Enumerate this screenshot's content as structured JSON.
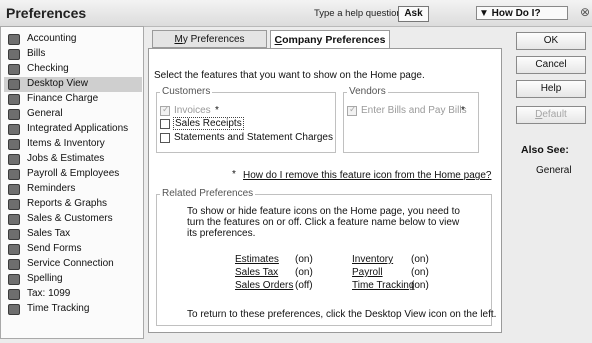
{
  "window": {
    "title": "Preferences",
    "help_label": "Type a help question",
    "ask_label": "Ask",
    "howdoi_label": "▼ How Do I?",
    "close_glyph": "⊗"
  },
  "sidebar": {
    "items": [
      {
        "label": "Accounting",
        "icon": "accounting-icon"
      },
      {
        "label": "Bills",
        "icon": "bills-icon"
      },
      {
        "label": "Checking",
        "icon": "checking-icon"
      },
      {
        "label": "Desktop View",
        "icon": "desktop-view-icon",
        "selected": true
      },
      {
        "label": "Finance Charge",
        "icon": "finance-charge-icon"
      },
      {
        "label": "General",
        "icon": "general-icon"
      },
      {
        "label": "Integrated Applications",
        "icon": "integrated-applications-icon"
      },
      {
        "label": "Items & Inventory",
        "icon": "items-inventory-icon"
      },
      {
        "label": "Jobs & Estimates",
        "icon": "jobs-estimates-icon"
      },
      {
        "label": "Payroll & Employees",
        "icon": "payroll-icon"
      },
      {
        "label": "Reminders",
        "icon": "reminders-icon"
      },
      {
        "label": "Reports & Graphs",
        "icon": "reports-graphs-icon"
      },
      {
        "label": "Sales & Customers",
        "icon": "sales-customers-icon"
      },
      {
        "label": "Sales Tax",
        "icon": "sales-tax-icon"
      },
      {
        "label": "Send Forms",
        "icon": "send-forms-icon"
      },
      {
        "label": "Service Connection",
        "icon": "service-connection-icon"
      },
      {
        "label": "Spelling",
        "icon": "spelling-icon"
      },
      {
        "label": "Tax: 1099",
        "icon": "tax-1099-icon"
      },
      {
        "label": "Time Tracking",
        "icon": "time-tracking-icon"
      }
    ]
  },
  "tabs": {
    "my_prefix": "M",
    "my_rest": "y Preferences",
    "company_prefix": "C",
    "company_rest": "ompany Preferences"
  },
  "panel": {
    "instruction": "Select the features that you want to show on the Home page.",
    "customers_legend": "Customers",
    "invoices_label": "Invoices",
    "invoices_star": "*",
    "sales_receipts_label": "Sales Receipts",
    "statements_label": "Statements and Statement Charges",
    "vendors_legend": "Vendors",
    "bills_label": "Enter Bills and Pay Bills",
    "bills_star": "*",
    "remove_star": "*",
    "remove_link": "How do I remove this feature icon from the Home page?",
    "related_legend": "Related Preferences",
    "related_text_1": "To show or hide feature icons on the Home page, you need to",
    "related_text_2": "turn the features on or off. Click a feature name below to view",
    "related_text_3": "its preferences.",
    "features": [
      {
        "name": "Estimates",
        "status": "(on)"
      },
      {
        "name": "Sales Tax",
        "status": "(on)"
      },
      {
        "name": "Sales Orders",
        "status": "(off)"
      },
      {
        "name": "Inventory",
        "status": "(on)"
      },
      {
        "name": "Payroll",
        "status": "(on)"
      },
      {
        "name": "Time Tracking",
        "status": "(on)"
      }
    ],
    "return_text": "To return to these preferences, click the Desktop View icon on the left."
  },
  "buttons": {
    "ok": "OK",
    "cancel": "Cancel",
    "help": "Help",
    "default_prefix": "D",
    "default_rest": "efault"
  },
  "also_see": {
    "title": "Also See:",
    "item": "General"
  }
}
